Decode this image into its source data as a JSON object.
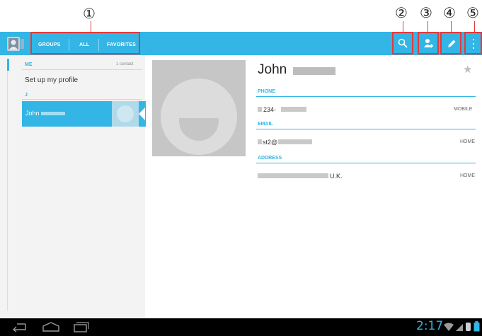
{
  "callouts": [
    "①",
    "②",
    "③",
    "④",
    "⑤"
  ],
  "actionbar": {
    "tabs": [
      "GROUPS",
      "ALL",
      "FAVORITES"
    ]
  },
  "left": {
    "me_header": "ME",
    "me_count": "1 contact",
    "profile_label": "Set up my profile",
    "j_header": "J",
    "selected_contact": "John"
  },
  "detail": {
    "name": "John",
    "phone": {
      "header": "PHONE",
      "value": "234-",
      "type": "MOBILE"
    },
    "email": {
      "header": "EMAIL",
      "value": "st2@",
      "type": "HOME"
    },
    "address": {
      "header": "ADDRESS",
      "value": "U.K.",
      "type": "HOME"
    }
  },
  "status": {
    "time": "2:17"
  },
  "colors": {
    "accent": "#33b5e5",
    "callout": "#e23b3b"
  }
}
